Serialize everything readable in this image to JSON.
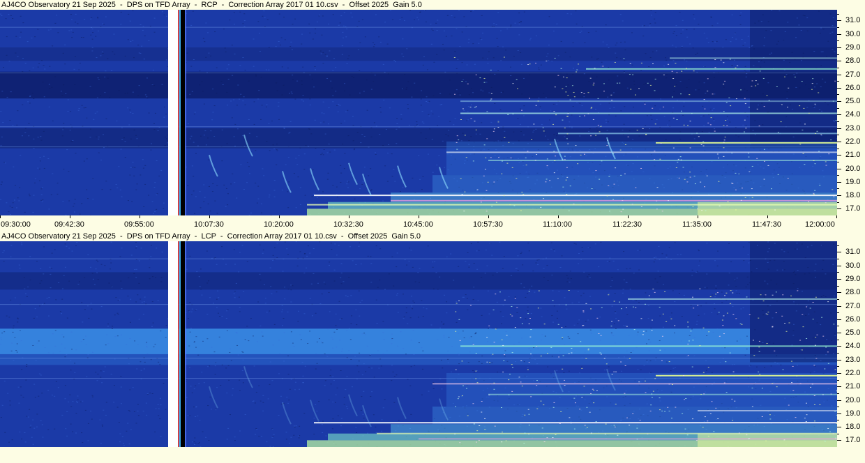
{
  "panels": [
    {
      "title": "AJ4CO Observatory 21 Sep 2025  -  DPS on TFD Array  -  RCP  -  Correction Array 2017 01 10.csv  -  Offset 2025  Gain 5.0",
      "polarization": "RCP"
    },
    {
      "title": "AJ4CO Observatory 21 Sep 2025  -  DPS on TFD Array  -  LCP  -  Correction Array 2017 01 10.csv  -  Offset 2025  Gain 5.0",
      "polarization": "LCP"
    }
  ],
  "chart_data": {
    "type": "heatmap",
    "x_tick_labels": [
      "09:30:00",
      "09:42:30",
      "09:55:00",
      "10:07:30",
      "10:20:00",
      "10:32:30",
      "10:45:00",
      "10:57:30",
      "11:10:00",
      "11:22:30",
      "11:35:00",
      "11:47:30",
      "12:00:00"
    ],
    "y_tick_labels": [
      "31.0",
      "30.0",
      "29.0",
      "28.0",
      "27.0",
      "26.0",
      "25.0",
      "24.0",
      "23.0",
      "22.0",
      "21.0",
      "20.0",
      "19.0",
      "18.0",
      "17.0"
    ],
    "x_range": [
      "09:30:00",
      "12:00:00"
    ],
    "y_range": [
      16.5,
      31.8
    ],
    "colors": {
      "background": "#1b3aa7",
      "dark_band": "#0d1f6b",
      "bright": "#7de3c8",
      "hot": "#e6f59a",
      "blanking": "#ffffff"
    }
  }
}
